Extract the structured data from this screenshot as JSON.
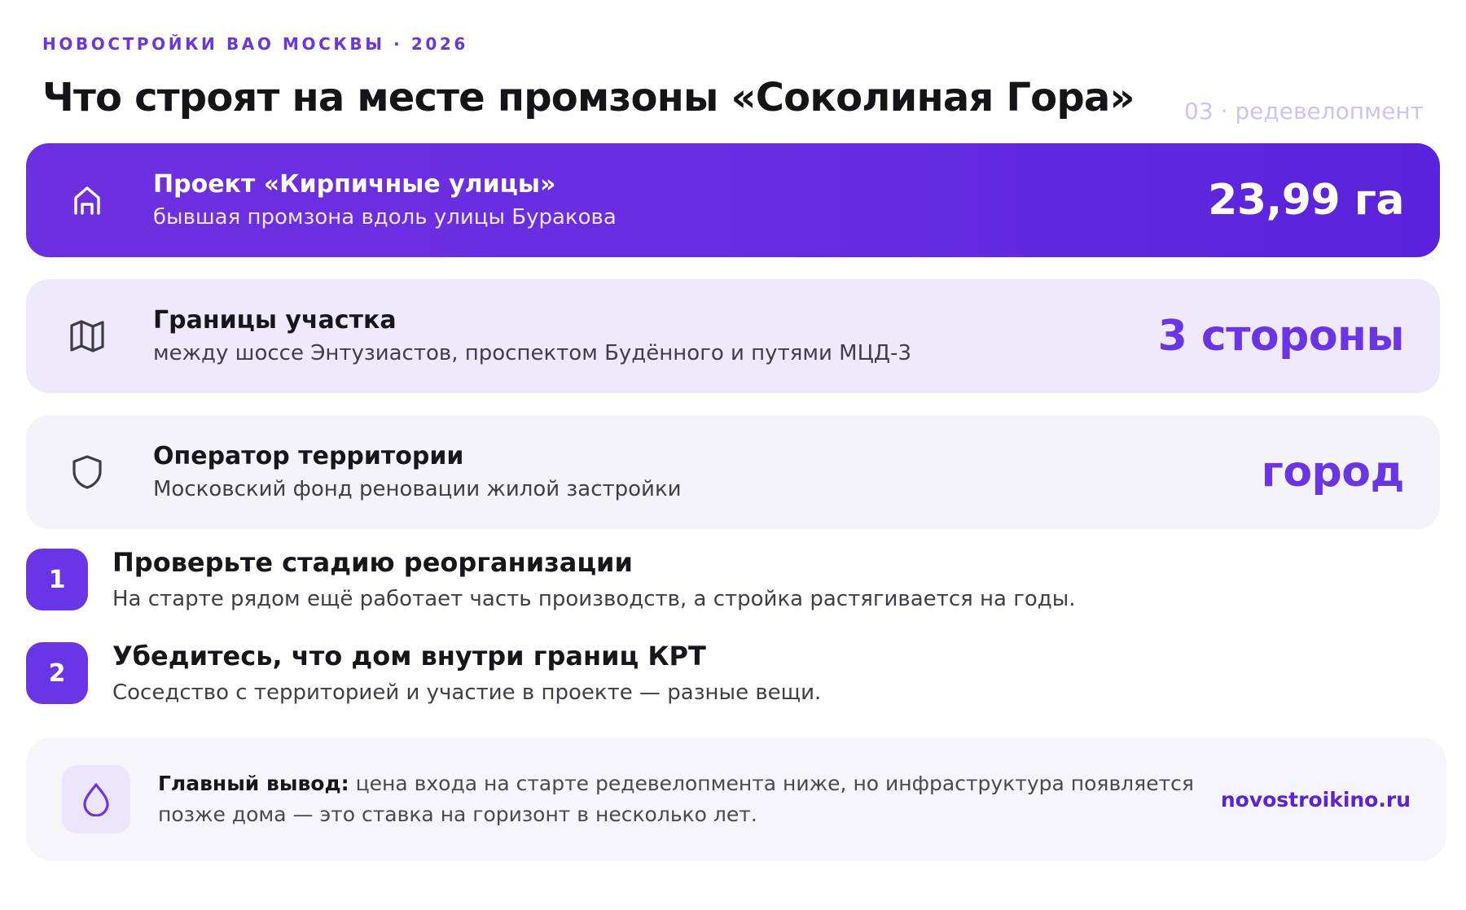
{
  "header": {
    "eyebrow": "НОВОСТРОЙКИ ВАО МОСКВЫ · 2026",
    "title": "Что строят на месте промзоны «Соколиная Гора»",
    "section_tag": "03 · редевелопмент"
  },
  "cards": [
    {
      "icon": "home-icon",
      "title": "Проект «Кирпичные улицы»",
      "desc": "бывшая промзона вдоль улицы Буракова",
      "metric": "23,99 га"
    },
    {
      "icon": "map-icon",
      "title": "Границы участка",
      "desc": "между шоссе Энтузиастов, проспектом Будённого и путями МЦД-3",
      "metric": "3 стороны"
    },
    {
      "icon": "shield-icon",
      "title": "Оператор территории",
      "desc": "Московский фонд реновации жилой застройки",
      "metric": "город"
    }
  ],
  "steps": [
    {
      "num": "1",
      "title": "Проверьте стадию реорганизации",
      "desc": "На старте рядом ещё работает часть производств, а стройка растягивается на годы."
    },
    {
      "num": "2",
      "title": "Убедитесь, что дом внутри границ КРТ",
      "desc": "Соседство с территорией и участие в проекте — разные вещи."
    }
  ],
  "footer": {
    "icon": "droplet-icon",
    "lead": "Главный вывод:",
    "text": "цена входа на старте редевелопмента ниже, но инфраструктура появляется позже дома — это ставка на горизонт в несколько лет.",
    "site": "novostroikino.ru"
  },
  "colors": {
    "accent": "#6a35e6",
    "accent_dark": "#5a22dc",
    "light_card": "#eeeafc",
    "gray_card": "#f4f3f8"
  }
}
